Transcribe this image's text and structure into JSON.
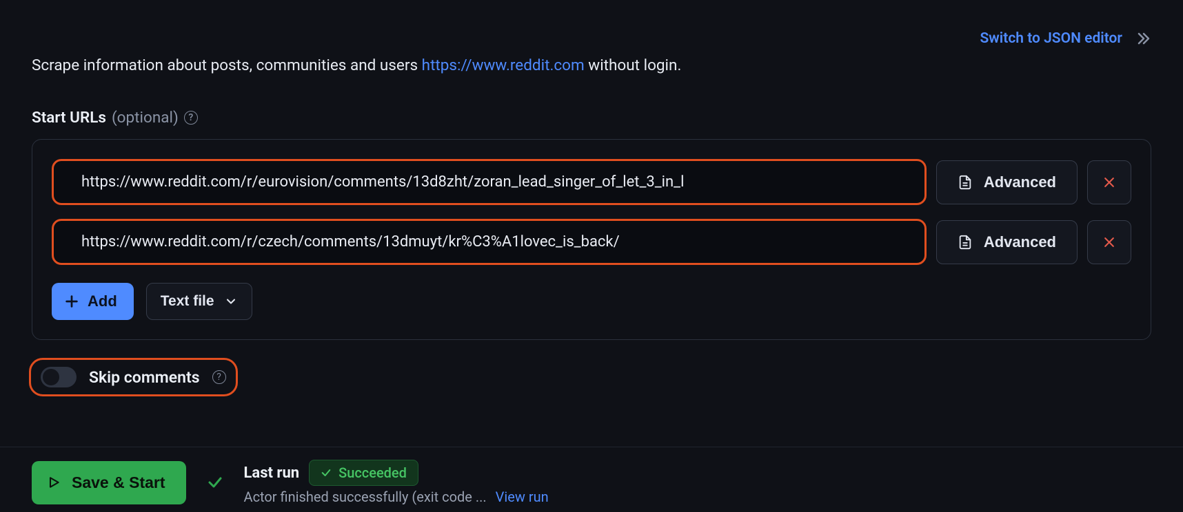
{
  "top": {
    "switch_json": "Switch to JSON editor"
  },
  "description": {
    "prefix": "Scrape information about posts, communities and users ",
    "link": "https://www.reddit.com",
    "suffix": " without login."
  },
  "start_urls": {
    "label": "Start URLs",
    "optional": "(optional)",
    "items": [
      {
        "url": "https://www.reddit.com/r/eurovision/comments/13d8zht/zoran_lead_singer_of_let_3_in_l"
      },
      {
        "url": "https://www.reddit.com/r/czech/comments/13dmuyt/kr%C3%A1lovec_is_back/"
      }
    ],
    "advanced_label": "Advanced",
    "add_label": "Add",
    "textfile_label": "Text file"
  },
  "skip_comments": {
    "label": "Skip comments",
    "value": false
  },
  "footer": {
    "save_start": "Save & Start",
    "last_run_label": "Last run",
    "status": "Succeeded",
    "subtext": "Actor finished successfully (exit code ...",
    "view_run": "View run"
  }
}
